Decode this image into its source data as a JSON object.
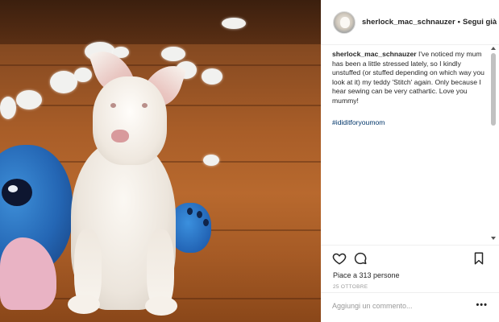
{
  "post": {
    "username": "sherlock_mac_schnauzer",
    "separator": "•",
    "follow_label": "Segui già",
    "caption_user": "sherlock_mac_schnauzer",
    "caption_text": " I've noticed my mum has been a little stressed lately, so I kindly unstuffed (or stuffed depending on which way you look at it) my teddy 'Stitch' again. Only because I hear sewing can be very cathartic. Love you mummy!",
    "hashtag": "#ididitforyoumom",
    "likes": "Piace a 313 persone",
    "date": "25 OTTOBRE",
    "comment_placeholder": "Aggiungi un commento...",
    "more_label": "•••"
  },
  "icons": {
    "like": "heart-icon",
    "comment": "comment-icon",
    "save": "bookmark-icon"
  }
}
